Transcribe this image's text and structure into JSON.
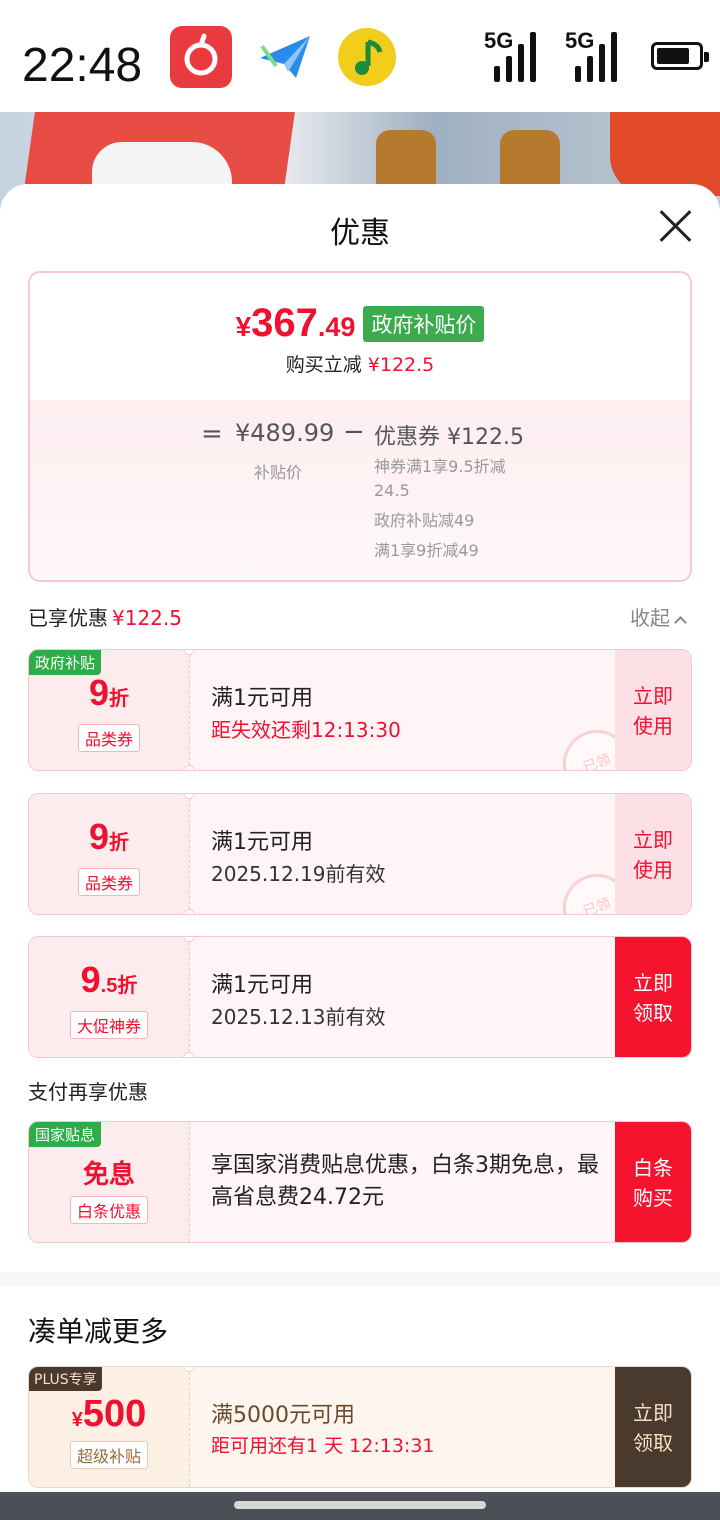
{
  "status_bar": {
    "time": "22:48",
    "apps": [
      "netease-music-icon",
      "send-plane-icon",
      "qq-music-icon"
    ],
    "network_1": "5G",
    "network_2": "5G",
    "battery_level": 0.8
  },
  "sheet": {
    "title": "优惠",
    "close_icon": "close-icon"
  },
  "price": {
    "currency": "¥",
    "integer": "367",
    "decimal": ".49",
    "gov_tag": "政府补贴价",
    "instant_label": "购买立减",
    "instant_value": "¥122.5",
    "equals": "=",
    "subsidy_price": "¥489.99",
    "subsidy_label": "补贴价",
    "minus": "−",
    "coupon_total": "优惠券 ¥122.5",
    "details": [
      "神券满1享9.5折减24.5",
      "政府补贴减49",
      "满1享9折减49"
    ]
  },
  "enjoyed": {
    "label": "已享优惠",
    "value": "¥122.5",
    "collapse": "收起"
  },
  "coupons": [
    {
      "flag": "政府补贴",
      "number": "9",
      "unit": "折",
      "kind": "品类券",
      "condition": "满1元可用",
      "sub": "距失效还剩12:13:30",
      "action": "立即使用",
      "stamp": "已领"
    },
    {
      "number": "9",
      "unit": "折",
      "kind": "品类券",
      "condition": "满1元可用",
      "sub": "2025.12.19前有效",
      "action": "立即使用",
      "stamp": "已领"
    },
    {
      "number": "9",
      "unit": ".5折",
      "kind": "大促神券",
      "condition": "满1元可用",
      "sub": "2025.12.13前有效",
      "action": "立即领取"
    }
  ],
  "payment": {
    "title": "支付再享优惠",
    "flag": "国家贴息",
    "big": "免息",
    "kind": "白条优惠",
    "text": "享国家消费贴息优惠，白条3期免息，最高省息费24.72元",
    "action": "白条购买"
  },
  "more": {
    "title": "凑单减更多",
    "flag": "PLUS专享",
    "currency": "¥",
    "amount": "500",
    "kind": "超级补贴",
    "condition": "满5000元可用",
    "sub": "距可用还有1 天 12:13:31",
    "action": "立即领取"
  },
  "colors": {
    "accent_red": "#f0102f",
    "gov_green": "#3bab4e",
    "plus_dark": "#4a3a2d"
  }
}
